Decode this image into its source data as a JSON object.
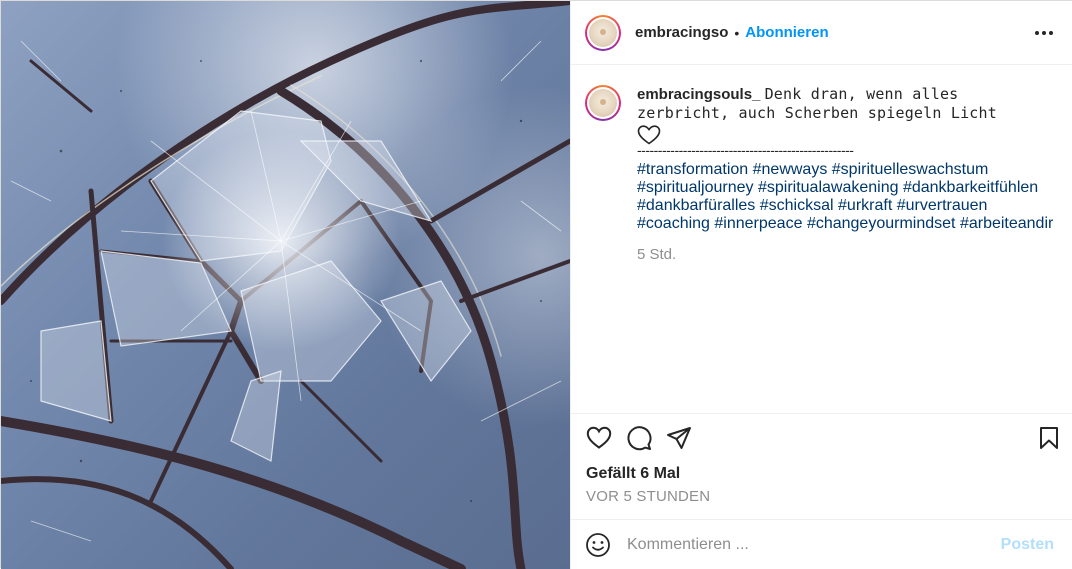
{
  "post": {
    "author": {
      "username_header": "embracingso",
      "separator": "•",
      "follow_label": "Abonnieren",
      "avatar_icon": "profile-avatar",
      "more_icon": "more-options-icon"
    },
    "caption": {
      "username": "embracingsouls_",
      "text": "Denk dran, wenn alles zerbricht, auch Scherben spiegeln Licht",
      "heart_icon": "outline-heart-emoji",
      "divider": "----------------------------------------------------",
      "hashtags": [
        "#transformation",
        "#newways",
        "#spirituelleswachstum",
        "#spiritualjourney",
        "#spiritualawakening",
        "#dankbarkeitfühlen",
        "#dankbarfüralles",
        "#schicksal",
        "#urkraft",
        "#urvertrauen",
        "#coaching",
        "#innerpeace",
        "#changeyourmindset",
        "#arbeiteandir"
      ],
      "time": "5 Std."
    },
    "actions": {
      "like_icon": "heart-icon",
      "comment_icon": "comment-icon",
      "share_icon": "share-icon",
      "save_icon": "bookmark-icon"
    },
    "likes_label": "Gefällt 6 Mal",
    "timestamp_label": "VOR 5 STUNDEN",
    "comment": {
      "emoji_icon": "smiley-icon",
      "placeholder": "Kommentieren ...",
      "post_label": "Posten"
    },
    "image": {
      "description_icon": "shattered-glass-photo"
    },
    "colors": {
      "link_blue": "#0095f6",
      "hashtag_blue": "#00376b",
      "disabled_post": "#b2dffc",
      "muted": "#8e8e8e"
    }
  }
}
